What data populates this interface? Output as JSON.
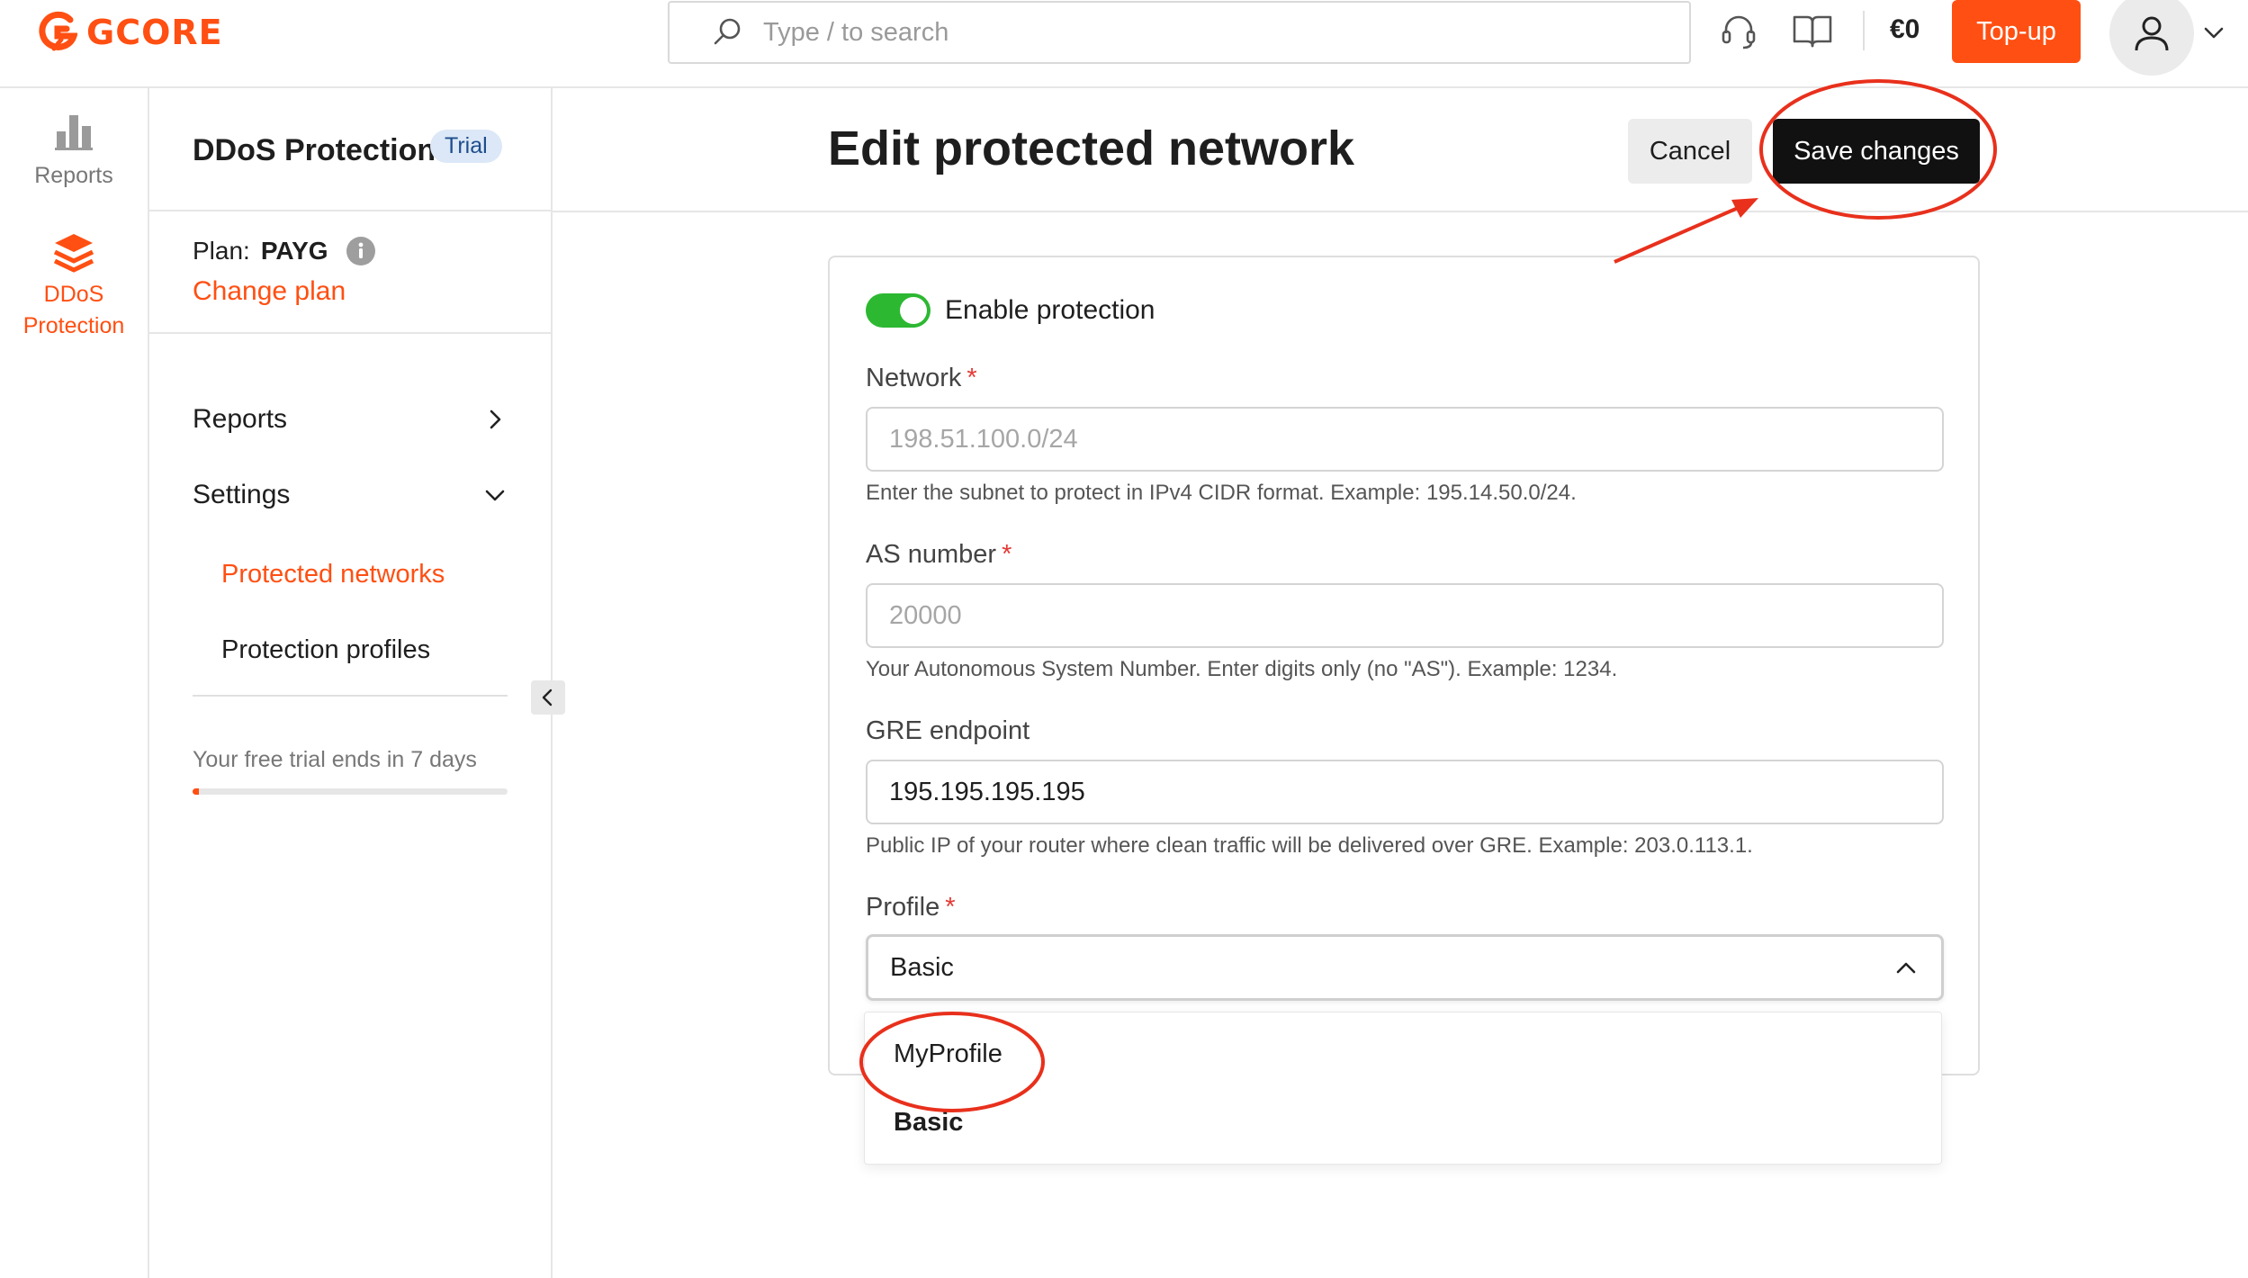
{
  "header": {
    "logo_text": "GCORE",
    "search_placeholder": "Type / to search",
    "balance": "€0",
    "topup_label": "Top-up"
  },
  "rail": {
    "items": [
      {
        "label": "Reports",
        "icon": "bar-chart-icon"
      },
      {
        "label_line1": "DDoS",
        "label_line2": "Protection",
        "icon": "layers-icon",
        "active": true
      }
    ]
  },
  "sidebar": {
    "title": "DDoS Protection",
    "badge": "Trial",
    "plan_label": "Plan:",
    "plan_value": "PAYG",
    "change_plan": "Change plan",
    "nav": {
      "reports": "Reports",
      "settings": "Settings",
      "protected_networks": "Protected networks",
      "protection_profiles": "Protection profiles"
    },
    "trial_text": "Your free trial ends in 7 days",
    "trial_progress": 0.02
  },
  "main": {
    "title": "Edit protected network",
    "cancel_label": "Cancel",
    "save_label": "Save changes"
  },
  "form": {
    "enable_protection": "Enable protection",
    "enable_on": true,
    "network": {
      "label": "Network",
      "required": "*",
      "placeholder": "198.51.100.0/24",
      "value": "",
      "help": "Enter the subnet to protect in IPv4 CIDR format. Example: 195.14.50.0/24."
    },
    "as_number": {
      "label": "AS number",
      "required": "*",
      "placeholder": "20000",
      "value": "",
      "help": "Your Autonomous System Number. Enter digits only (no \"AS\"). Example: 1234."
    },
    "gre_endpoint": {
      "label": "GRE endpoint",
      "value": "195.195.195.195",
      "help": "Public IP of your router where clean traffic will be delivered over GRE. Example: 203.0.113.1."
    },
    "profile": {
      "label": "Profile",
      "required": "*",
      "selected": "Basic",
      "options": [
        "MyProfile",
        "Basic"
      ]
    }
  },
  "colors": {
    "brand": "#ff4f12",
    "toggle_on": "#2db832",
    "annotation": "#e8301c"
  }
}
